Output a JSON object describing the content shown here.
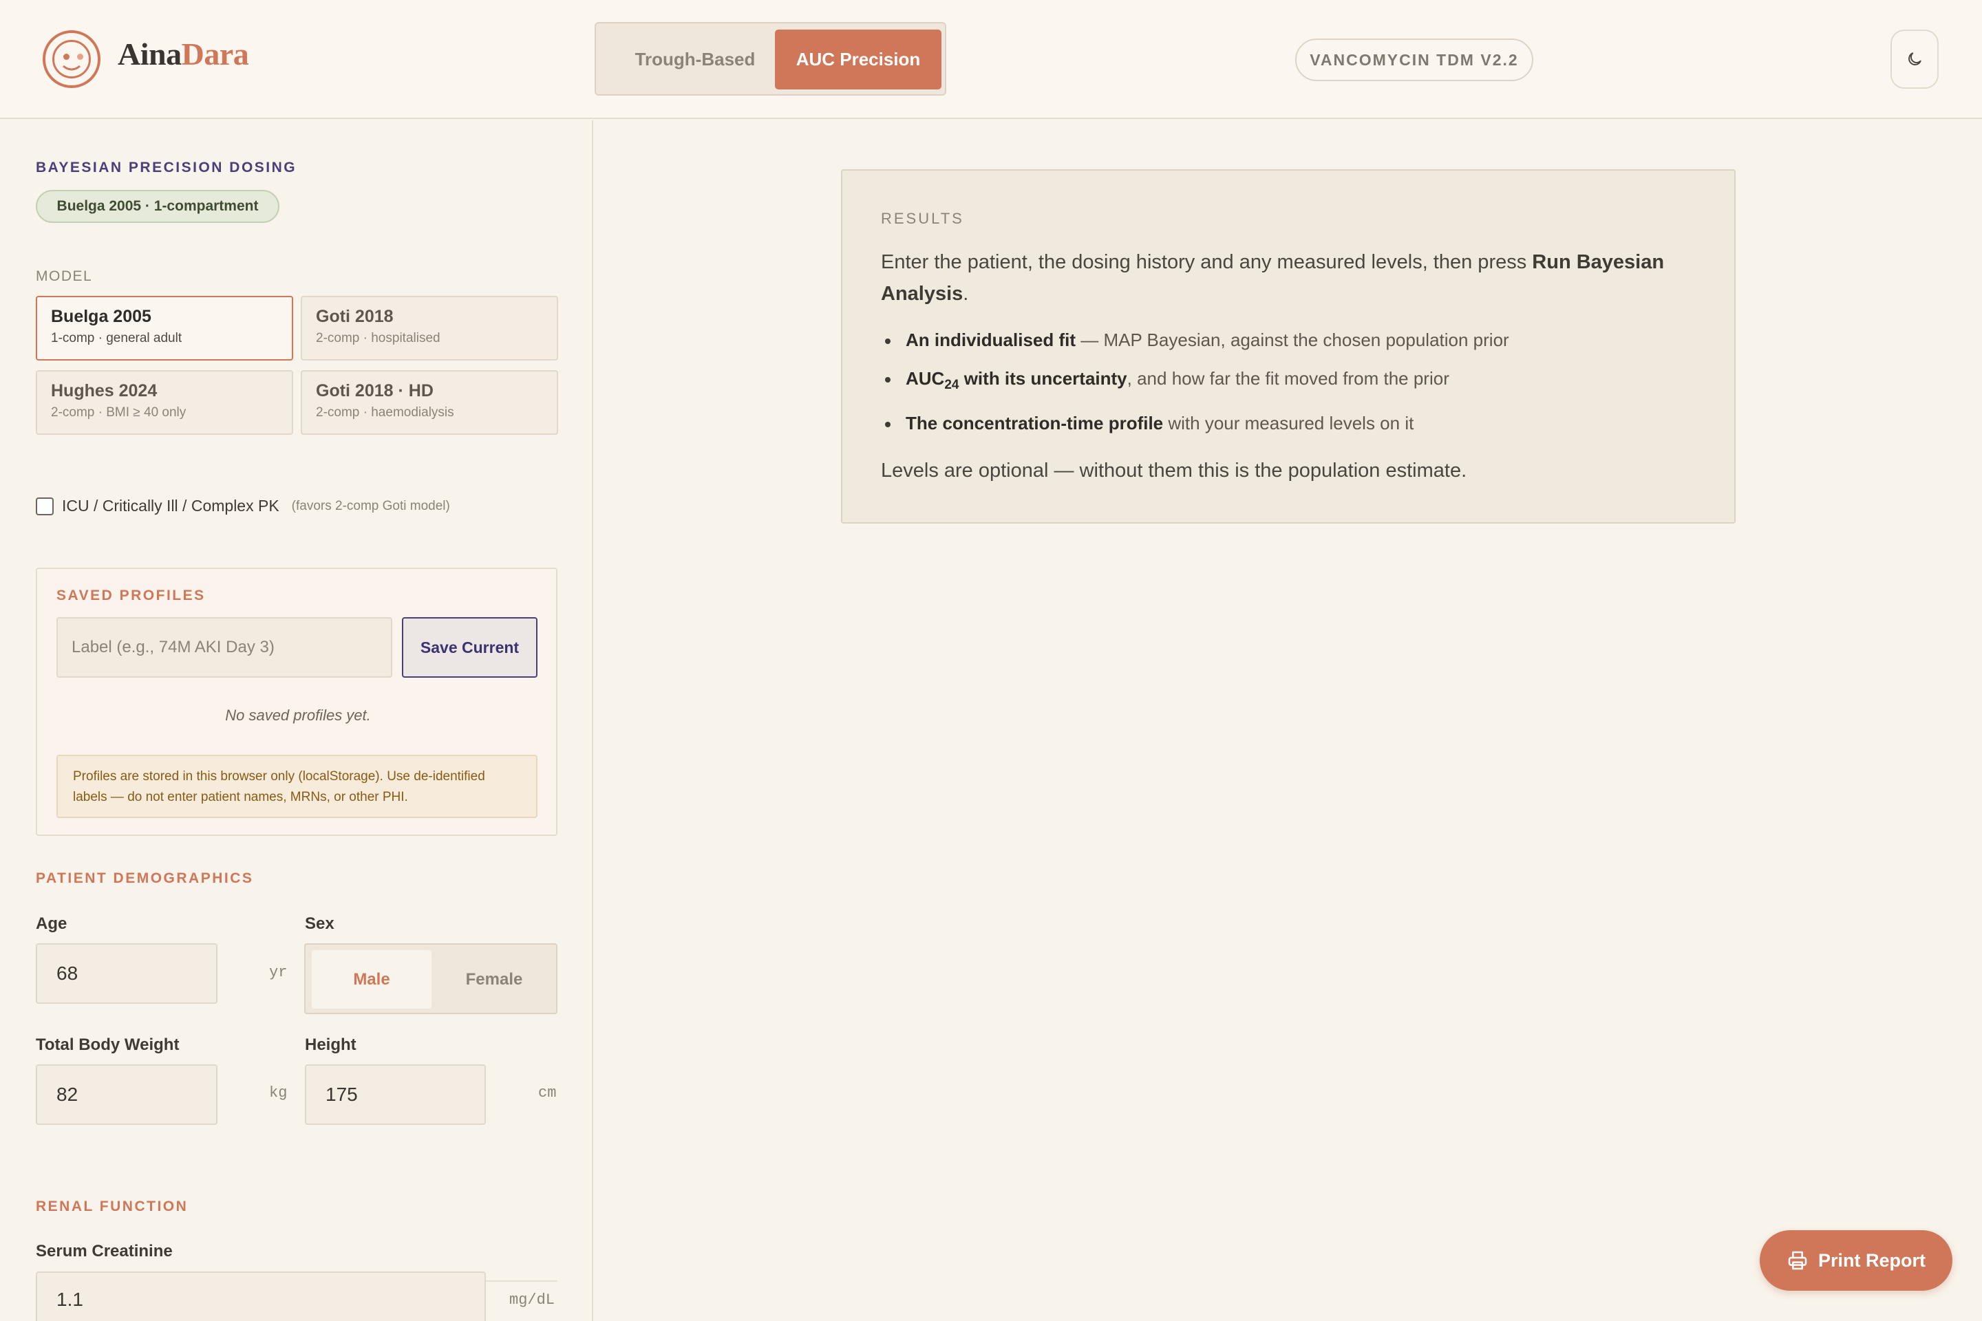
{
  "header": {
    "brand_part1": "Aina",
    "brand_part2": "Dara",
    "modes": [
      "Trough-Based",
      "AUC Precision"
    ],
    "active_mode": "AUC Precision",
    "version": "VANCOMYCIN TDM V2.2",
    "theme_icon": "moon-icon"
  },
  "sidebar": {
    "section_title": "BAYESIAN PRECISION DOSING",
    "model_pill": "Buelga 2005 · 1-compartment",
    "model_label": "MODEL",
    "models": [
      {
        "name": "Buelga 2005",
        "sub": "1-comp · general adult"
      },
      {
        "name": "Goti 2018",
        "sub": "2-comp · hospitalised"
      },
      {
        "name": "Hughes 2024",
        "sub": "2-comp · BMI ≥ 40 only"
      },
      {
        "name": "Goti 2018 · HD",
        "sub": "2-comp · haemodialysis"
      }
    ],
    "selected_model": "Buelga 2005",
    "icu_label": "ICU / Critically Ill / Complex PK",
    "icu_hint": "(favors 2-comp Goti model)",
    "profiles": {
      "title": "SAVED PROFILES",
      "placeholder": "Label (e.g., 74M AKI Day 3)",
      "save_label": "Save Current",
      "empty_text": "No saved profiles yet.",
      "warning": "Profiles are stored in this browser only (localStorage). Use de-identified labels — do not enter patient names, MRNs, or other PHI."
    },
    "demographics": {
      "title": "PATIENT DEMOGRAPHICS",
      "age_label": "Age",
      "age_value": "68",
      "age_unit": "yr",
      "sex_label": "Sex",
      "sex_options": [
        "Male",
        "Female"
      ],
      "sex_selected": "Male",
      "weight_label": "Total Body Weight",
      "weight_value": "82",
      "weight_unit": "kg",
      "height_label": "Height",
      "height_value": "175",
      "height_unit": "cm"
    },
    "renal": {
      "title": "RENAL FUNCTION",
      "scr_label": "Serum Creatinine",
      "scr_value": "1.1",
      "scr_unit": "mg/dL"
    }
  },
  "results": {
    "title": "RESULTS",
    "intro_prefix": "Enter the patient, the dosing history and any measured levels, then press ",
    "intro_bold": "Run Bayesian Analysis",
    "intro_suffix": ".",
    "items": [
      {
        "bold": "An individualised fit",
        "rest": " — MAP Bayesian, against the chosen population prior"
      },
      {
        "bold_pre": "AUC",
        "sub": "24",
        "bold_post": " with its uncertainty",
        "rest": ", and how far the fit moved from the prior"
      },
      {
        "bold": "The concentration-time profile",
        "rest": " with your measured levels on it"
      }
    ],
    "footer": "Levels are optional — without them this is the population estimate."
  },
  "print_label": "Print Report",
  "colors": {
    "accent": "#cf7758",
    "purple": "#4a3f7a",
    "background": "#f8f3eb"
  }
}
